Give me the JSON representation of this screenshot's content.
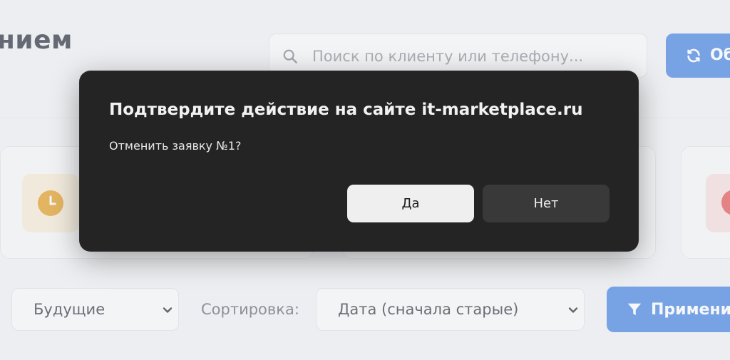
{
  "page": {
    "title_fragment": "нием",
    "search": {
      "placeholder": "Поиск по клиенту или телефону..."
    },
    "refresh_button_label": "Об",
    "filters": {
      "status_select_value": "Будущие",
      "sort_label": "Сортировка:",
      "sort_select_value": "Дата (сначала старые)",
      "apply_button_label": "Применит"
    }
  },
  "dialog": {
    "title": "Подтвердите действие на сайте it-marketplace.ru",
    "message": "Отменить заявку №1?",
    "confirm_label": "Да",
    "cancel_label": "Нет"
  },
  "icons": {
    "search": "search-icon",
    "refresh": "refresh-icon",
    "filter": "filter-icon",
    "clock": "clock-icon",
    "chevron": "chevron-down-icon"
  },
  "colors": {
    "accent": "#3d7ee0",
    "dialog_bg": "#252424",
    "pending": "#e29a1a",
    "danger": "#e24d4d"
  }
}
